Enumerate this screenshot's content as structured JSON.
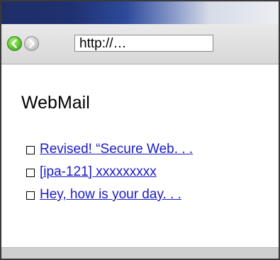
{
  "browser": {
    "address": "http://…"
  },
  "page": {
    "title": "WebMail"
  },
  "mail": {
    "items": [
      {
        "subject": "Revised! “Secure Web. . ."
      },
      {
        "subject": "[ipa-121] xxxxxxxxx"
      },
      {
        "subject": "Hey, how is your day. . ."
      }
    ]
  },
  "icons": {
    "back": "back-arrow-icon",
    "forward": "forward-arrow-icon",
    "checkbox": "checkbox-icon"
  },
  "colors": {
    "titlebar_dark": "#1e2f68",
    "back_button": "#5cc52f",
    "link": "#1a1ac8"
  }
}
